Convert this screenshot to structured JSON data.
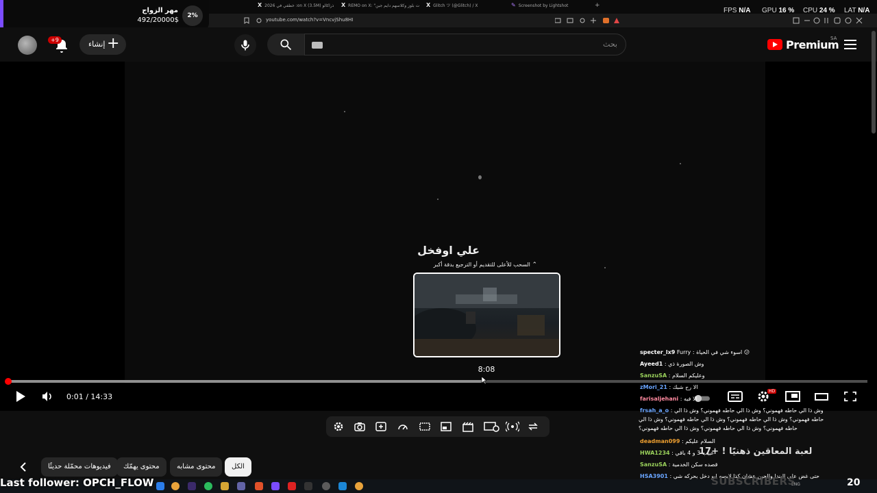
{
  "browser": {
    "tabs": [
      {
        "title": "خطفي في 2026 :on X (3.5M) ذراكالو",
        "icon": "x-icon"
      },
      {
        "title": "REMO on X: \"ت بلوز وكلاسهم دايم جبن",
        "icon": "x-icon"
      },
      {
        "title": "Glitch ツ (@Glitch) / X",
        "icon": "x-icon"
      },
      {
        "title": "Screenshot by Lightshot",
        "icon": "lightshot-icon"
      }
    ],
    "url": "youtube.com/watch?v=VncvjShu8HI"
  },
  "perf_overlay": {
    "fps_label": "FPS",
    "fps_value": "N/A",
    "gpu_label": "GPU",
    "gpu_value": "16 %",
    "cpu_label": "CPU",
    "cpu_value": "24 %",
    "lat_label": "LAT",
    "lat_value": "N/A"
  },
  "donation": {
    "percent": "2%",
    "title": "مهر الزواج",
    "amount": "492/20000$",
    "progress": 0.02
  },
  "header": {
    "notifications_badge": "+9",
    "create_label": "إنشاء",
    "search_placeholder": "بحث",
    "logo_text": "Premium",
    "country": "SA"
  },
  "player": {
    "chapter_title": "علي اوفخل",
    "seek_hint": "السحب للأعلى للتقديم أو الترجيع بدقة أكبر",
    "preview_time": "8:08",
    "current_time": "0:01",
    "duration": "14:33",
    "progress_fraction": 0.0012,
    "hover_fraction": 0.555,
    "hd_badge": "HD"
  },
  "toolbar_icons": [
    "settings-icon",
    "camera-icon",
    "add-frame-icon",
    "speed-icon",
    "crop-icon",
    "picture-in-picture-icon",
    "clapper-icon",
    "cast-icon",
    "radio-icon",
    "loop-icon"
  ],
  "chips": {
    "items": [
      {
        "label": "الكل",
        "active": true
      },
      {
        "label": "محتوى مشابه",
        "active": false
      },
      {
        "label": "محتوى يهمّك",
        "active": false
      },
      {
        "label": "فيديوهات محمّلة حديثًا",
        "active": false
      }
    ]
  },
  "chat": {
    "messages": [
      {
        "user": "specter_lx9",
        "color": "#ffffff",
        "text": "Furry : اسوء شي في الحياة 😕"
      },
      {
        "user": "Ayeed1",
        "color": "#ffffff",
        "text": ": وش الصورة ذي"
      },
      {
        "user": "SanzuSA",
        "color": "#9ad15b",
        "text": ": وعليكم السلام"
      },
      {
        "user": "zMori_21",
        "color": "#6aa5ff",
        "text": ": الا رح شبك"
      },
      {
        "user": "farisaljehani",
        "color": "#ff8aa0",
        "text": ": الا فيه"
      },
      {
        "user": "frsah_a_o",
        "color": "#6aa5ff",
        "text": ": وش ذا الي حاطه فهموني؟ وش ذا الي حاطه فهموني؟ وش ذا الي"
      },
      {
        "user": "",
        "color": "#ffffff",
        "text": "حاطه فهموني؟ وش ذا الي حاطه فهموني؟ وش ذا الي حاطه فهموني؟ وش ذا الي"
      },
      {
        "user": "",
        "color": "#ffffff",
        "text": "حاطه فهموني؟ وش ذا الي حاطه فهموني؟ وش ذا الي حاطه فهموني؟"
      },
      {
        "user": "deadman099",
        "color": "#f0a030",
        "text": ": السلام عليكم"
      },
      {
        "user": "HWA1234",
        "color": "#9ad15b",
        "text": ": عييب 3 و 4 باقي"
      },
      {
        "user": "SanzuSA",
        "color": "#9ad15b",
        "text": ": قصده سكن الخدمية"
      },
      {
        "user": "HSA3901",
        "color": "#6aa5ff",
        "text": ": حتى غض على البندا والحين عشان كذا لابسه ابو دخل بحركه شي"
      }
    ],
    "game_title": "لعبة المعاقين ذهنيًا ! +17",
    "last_follower": "Last follower: OPCH_FLOW",
    "subscribers_label": "SUBSCRIBERS",
    "taskbar_lang": "ENG",
    "clock_number": "20"
  }
}
